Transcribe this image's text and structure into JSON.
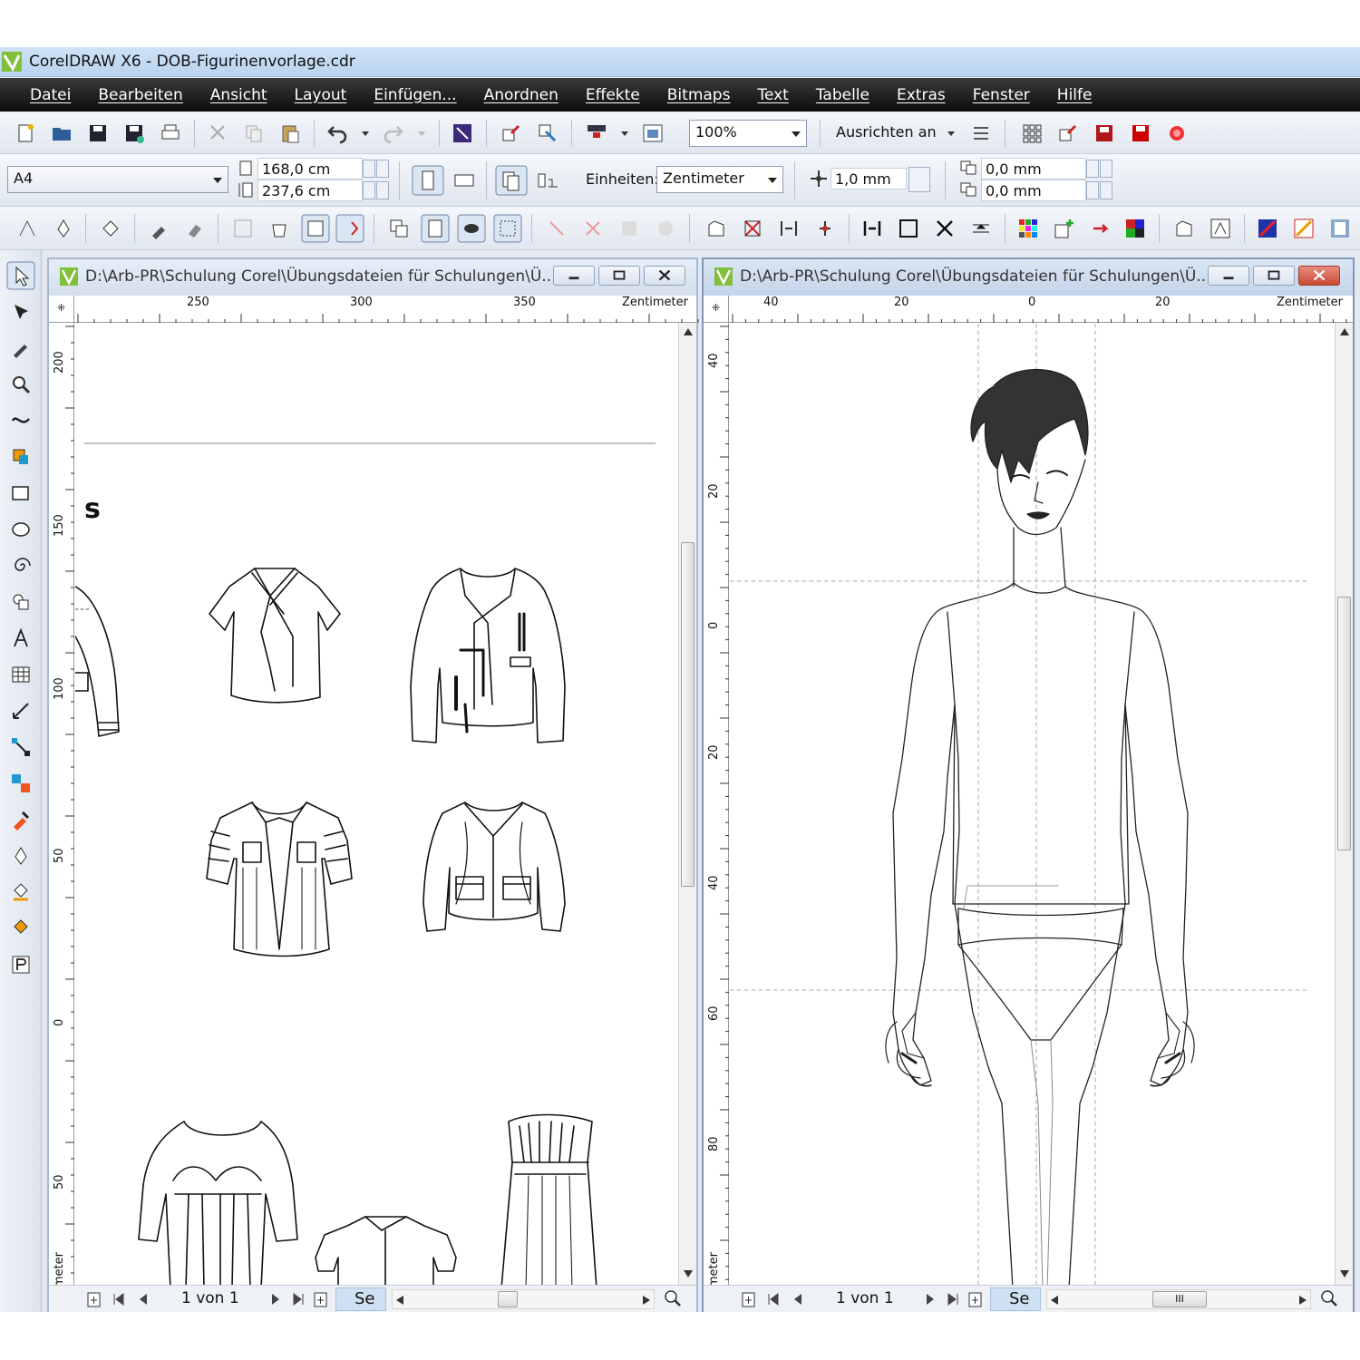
{
  "app": {
    "title": "CorelDRAW X6 - DOB-Figurinenvorlage.cdr",
    "logo_icon": "coreldraw-logo-icon"
  },
  "menu": [
    "Datei",
    "Bearbeiten",
    "Ansicht",
    "Layout",
    "Einfügen...",
    "Anordnen",
    "Effekte",
    "Bitmaps",
    "Text",
    "Tabelle",
    "Extras",
    "Fenster",
    "Hilfe"
  ],
  "standard_toolbar": {
    "zoom": "100%",
    "snap_label": "Ausrichten an"
  },
  "property_bar": {
    "page_size": "A4",
    "width": "168,0 cm",
    "height": "237,6 cm",
    "units_label": "Einheiten:",
    "units_value": "Zentimeter",
    "nudge": "1,0 mm",
    "dup_x": "0,0 mm",
    "dup_y": "0,0 mm"
  },
  "doc1": {
    "title": "D:\\Arb-PR\\Schulung Corel\\Übungsdateien für Schulungen\\Ü...",
    "ruler_unit": "Zentimeter",
    "h_labels": [
      "250",
      "300",
      "350"
    ],
    "v_labels": [
      "200",
      "150",
      "100",
      "50",
      "0",
      "50"
    ],
    "v_unit": "Zentimeter",
    "page_text": "s",
    "page_nav": "1 von 1",
    "page_tab": "Se"
  },
  "doc2": {
    "title": "D:\\Arb-PR\\Schulung Corel\\Übungsdateien für Schulungen\\Ü...",
    "ruler_unit": "Zentimeter",
    "h_labels": [
      "40",
      "20",
      "0",
      "20"
    ],
    "v_labels": [
      "40",
      "20",
      "0",
      "20",
      "40",
      "60",
      "80"
    ],
    "v_unit": "Zentimeter",
    "page_nav": "1 von 1",
    "page_tab": "Se",
    "scroll_grip": "III"
  },
  "colors": {
    "menubar": "#111111",
    "titlebar": "#c4daf2",
    "close_button": "#d45a44",
    "page_tab": "#cfe0f3"
  }
}
